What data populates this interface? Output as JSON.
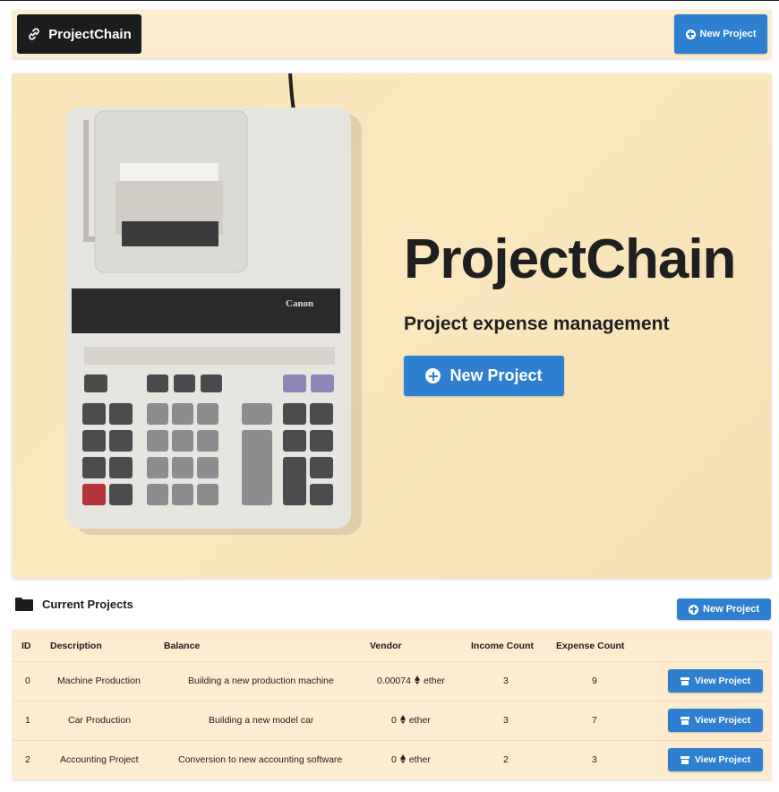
{
  "app": {
    "brand": "ProjectChain"
  },
  "header": {
    "new_project_label": "New Project"
  },
  "hero": {
    "title": "ProjectChain",
    "subtitle": "Project expense management",
    "new_project_label": "New Project"
  },
  "projects": {
    "section_title": "Current Projects",
    "new_project_label": "New Project",
    "columns": [
      "ID",
      "Description",
      "Balance",
      "Vendor",
      "Income Count",
      "Expense Count"
    ],
    "view_label": "View Project",
    "rows": [
      {
        "id": "0",
        "name": "Machine Production",
        "description": "Building a new production machine",
        "balance": "0.00074",
        "unit": "ether",
        "income_count": "3",
        "expense_count": "9"
      },
      {
        "id": "1",
        "name": "Car Production",
        "description": "Building a new model car",
        "balance": "0",
        "unit": "ether",
        "income_count": "3",
        "expense_count": "7"
      },
      {
        "id": "2",
        "name": "Accounting Project",
        "description": "Conversion to new accounting software",
        "balance": "0",
        "unit": "ether",
        "income_count": "2",
        "expense_count": "3"
      }
    ]
  },
  "colors": {
    "accent": "#2e7fcf",
    "panel": "#fdeccf",
    "brand_bg": "#1b1c1d"
  }
}
